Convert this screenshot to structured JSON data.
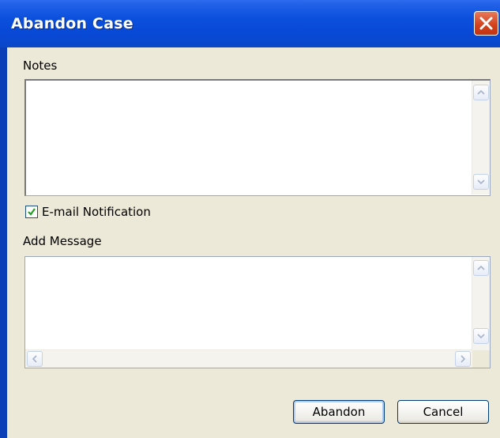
{
  "window": {
    "title": "Abandon Case"
  },
  "notes": {
    "label": "Notes",
    "value": ""
  },
  "email_notification": {
    "label": "E-mail Notification",
    "checked": true
  },
  "message": {
    "label": "Add Message",
    "value": ""
  },
  "buttons": {
    "abandon": "Abandon",
    "cancel": "Cancel"
  },
  "icons": {
    "close": "close-icon",
    "scroll_up": "chevron-up-icon",
    "scroll_down": "chevron-down-icon",
    "scroll_left": "chevron-left-icon",
    "scroll_right": "chevron-right-icon",
    "check": "checkmark-icon"
  },
  "colors": {
    "titlebar": "#0a4fdc",
    "close_button": "#d2401a",
    "dialog_background": "#ece9d8"
  }
}
